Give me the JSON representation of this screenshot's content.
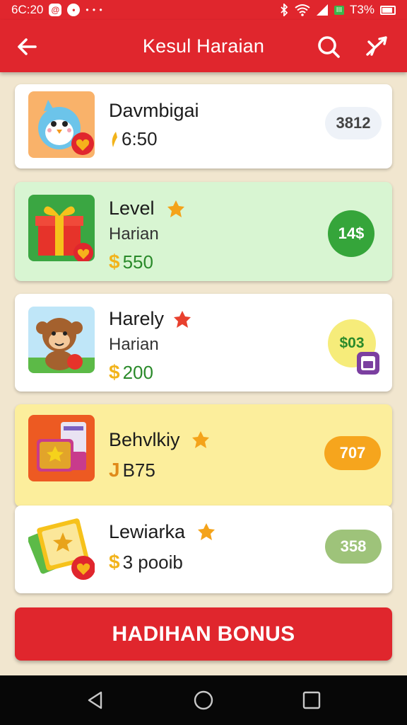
{
  "status_bar": {
    "time": "6C:20",
    "icon_a": "@",
    "icon_b": "•",
    "dots": "• • •",
    "battery_label": "III",
    "battery_pct": "T3%"
  },
  "header": {
    "title": "Kesul Haraian",
    "back_icon": "arrow-left-icon",
    "search_icon": "search-icon",
    "share_icon": "send-icon"
  },
  "rewards": [
    {
      "name": "Davmbigai",
      "sub": "",
      "currency": "",
      "amount": "6:50",
      "pill": "3812",
      "pill_color": "#eef2f8",
      "pill_text_color": "#444444",
      "bg": "#ffffff"
    },
    {
      "name": "Level",
      "sub": "Harian",
      "currency": "$",
      "amount": "550",
      "pill": "14$",
      "pill_color": "#35a53a",
      "pill_text_color": "#ffffff",
      "bg": "#d8f5d2"
    },
    {
      "name": "Harely",
      "sub": "Harian",
      "currency": "$",
      "amount": "200",
      "pill": "$03",
      "pill_color": "#f6ec7a",
      "pill_text_color": "#2a8a2a",
      "bg": "#ffffff"
    },
    {
      "name": "Behvlkiy",
      "sub": "",
      "currency": "J",
      "amount": "B75",
      "pill": "707",
      "pill_color": "#f6a51d",
      "pill_text_color": "#ffffff",
      "bg": "#fcee9c"
    },
    {
      "name": "Lewiarka",
      "sub": "",
      "currency": "$",
      "amount": "3 pooib",
      "pill": "358",
      "pill_color": "#9ec37a",
      "pill_text_color": "#ffffff",
      "bg": "#ffffff"
    }
  ],
  "bonus_button": {
    "label": "HADIHAN BONUS"
  },
  "nav": {
    "back": "nav-back-icon",
    "home": "nav-home-icon",
    "recents": "nav-recents-icon"
  }
}
